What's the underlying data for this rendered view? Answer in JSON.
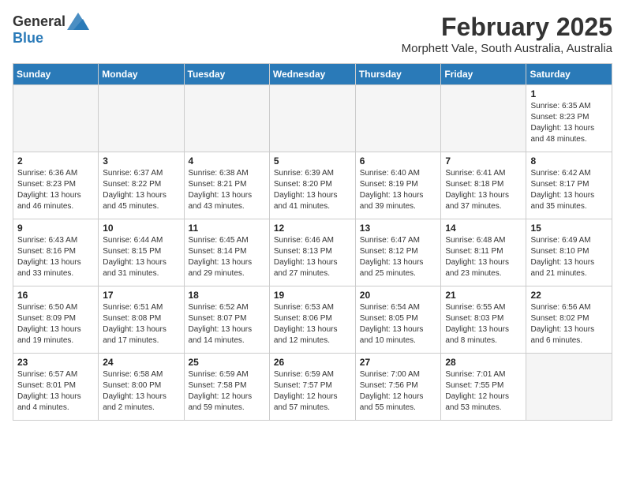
{
  "header": {
    "logo": {
      "general": "General",
      "blue": "Blue"
    },
    "title": "February 2025",
    "location": "Morphett Vale, South Australia, Australia"
  },
  "columns": [
    "Sunday",
    "Monday",
    "Tuesday",
    "Wednesday",
    "Thursday",
    "Friday",
    "Saturday"
  ],
  "weeks": [
    [
      {
        "day": "",
        "info": ""
      },
      {
        "day": "",
        "info": ""
      },
      {
        "day": "",
        "info": ""
      },
      {
        "day": "",
        "info": ""
      },
      {
        "day": "",
        "info": ""
      },
      {
        "day": "",
        "info": ""
      },
      {
        "day": "1",
        "info": "Sunrise: 6:35 AM\nSunset: 8:23 PM\nDaylight: 13 hours\nand 48 minutes."
      }
    ],
    [
      {
        "day": "2",
        "info": "Sunrise: 6:36 AM\nSunset: 8:23 PM\nDaylight: 13 hours\nand 46 minutes."
      },
      {
        "day": "3",
        "info": "Sunrise: 6:37 AM\nSunset: 8:22 PM\nDaylight: 13 hours\nand 45 minutes."
      },
      {
        "day": "4",
        "info": "Sunrise: 6:38 AM\nSunset: 8:21 PM\nDaylight: 13 hours\nand 43 minutes."
      },
      {
        "day": "5",
        "info": "Sunrise: 6:39 AM\nSunset: 8:20 PM\nDaylight: 13 hours\nand 41 minutes."
      },
      {
        "day": "6",
        "info": "Sunrise: 6:40 AM\nSunset: 8:19 PM\nDaylight: 13 hours\nand 39 minutes."
      },
      {
        "day": "7",
        "info": "Sunrise: 6:41 AM\nSunset: 8:18 PM\nDaylight: 13 hours\nand 37 minutes."
      },
      {
        "day": "8",
        "info": "Sunrise: 6:42 AM\nSunset: 8:17 PM\nDaylight: 13 hours\nand 35 minutes."
      }
    ],
    [
      {
        "day": "9",
        "info": "Sunrise: 6:43 AM\nSunset: 8:16 PM\nDaylight: 13 hours\nand 33 minutes."
      },
      {
        "day": "10",
        "info": "Sunrise: 6:44 AM\nSunset: 8:15 PM\nDaylight: 13 hours\nand 31 minutes."
      },
      {
        "day": "11",
        "info": "Sunrise: 6:45 AM\nSunset: 8:14 PM\nDaylight: 13 hours\nand 29 minutes."
      },
      {
        "day": "12",
        "info": "Sunrise: 6:46 AM\nSunset: 8:13 PM\nDaylight: 13 hours\nand 27 minutes."
      },
      {
        "day": "13",
        "info": "Sunrise: 6:47 AM\nSunset: 8:12 PM\nDaylight: 13 hours\nand 25 minutes."
      },
      {
        "day": "14",
        "info": "Sunrise: 6:48 AM\nSunset: 8:11 PM\nDaylight: 13 hours\nand 23 minutes."
      },
      {
        "day": "15",
        "info": "Sunrise: 6:49 AM\nSunset: 8:10 PM\nDaylight: 13 hours\nand 21 minutes."
      }
    ],
    [
      {
        "day": "16",
        "info": "Sunrise: 6:50 AM\nSunset: 8:09 PM\nDaylight: 13 hours\nand 19 minutes."
      },
      {
        "day": "17",
        "info": "Sunrise: 6:51 AM\nSunset: 8:08 PM\nDaylight: 13 hours\nand 17 minutes."
      },
      {
        "day": "18",
        "info": "Sunrise: 6:52 AM\nSunset: 8:07 PM\nDaylight: 13 hours\nand 14 minutes."
      },
      {
        "day": "19",
        "info": "Sunrise: 6:53 AM\nSunset: 8:06 PM\nDaylight: 13 hours\nand 12 minutes."
      },
      {
        "day": "20",
        "info": "Sunrise: 6:54 AM\nSunset: 8:05 PM\nDaylight: 13 hours\nand 10 minutes."
      },
      {
        "day": "21",
        "info": "Sunrise: 6:55 AM\nSunset: 8:03 PM\nDaylight: 13 hours\nand 8 minutes."
      },
      {
        "day": "22",
        "info": "Sunrise: 6:56 AM\nSunset: 8:02 PM\nDaylight: 13 hours\nand 6 minutes."
      }
    ],
    [
      {
        "day": "23",
        "info": "Sunrise: 6:57 AM\nSunset: 8:01 PM\nDaylight: 13 hours\nand 4 minutes."
      },
      {
        "day": "24",
        "info": "Sunrise: 6:58 AM\nSunset: 8:00 PM\nDaylight: 13 hours\nand 2 minutes."
      },
      {
        "day": "25",
        "info": "Sunrise: 6:59 AM\nSunset: 7:58 PM\nDaylight: 12 hours\nand 59 minutes."
      },
      {
        "day": "26",
        "info": "Sunrise: 6:59 AM\nSunset: 7:57 PM\nDaylight: 12 hours\nand 57 minutes."
      },
      {
        "day": "27",
        "info": "Sunrise: 7:00 AM\nSunset: 7:56 PM\nDaylight: 12 hours\nand 55 minutes."
      },
      {
        "day": "28",
        "info": "Sunrise: 7:01 AM\nSunset: 7:55 PM\nDaylight: 12 hours\nand 53 minutes."
      },
      {
        "day": "",
        "info": ""
      }
    ]
  ]
}
